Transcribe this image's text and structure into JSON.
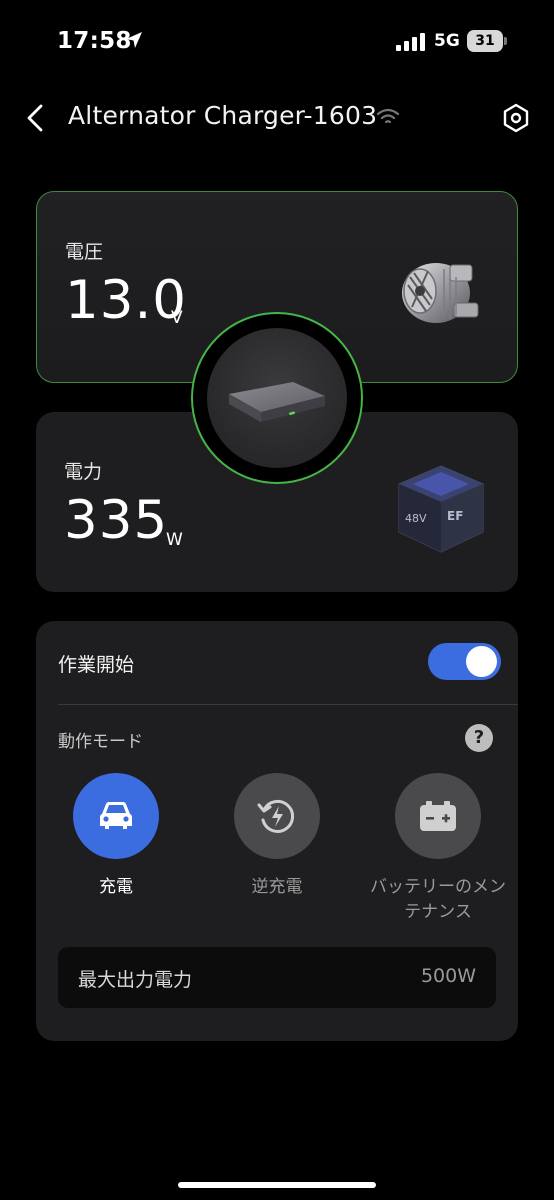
{
  "status_bar": {
    "time": "17:58",
    "network": "5G",
    "battery": "31",
    "icons": [
      "location-arrow-icon",
      "signal-icon",
      "battery-icon"
    ]
  },
  "nav": {
    "title": "Alternator Charger-1603",
    "icons": [
      "back-chevron-icon",
      "wifi-icon",
      "settings-hexagon-icon"
    ]
  },
  "voltage": {
    "label": "電圧",
    "value": "13.0",
    "unit": "V"
  },
  "power": {
    "label": "電力",
    "value": "335",
    "unit": "W",
    "battery_badge": "48V",
    "brand_mark": "EF"
  },
  "control": {
    "work_label": "作業開始",
    "work_enabled": true,
    "mode_label": "動作モード",
    "help_glyph": "?",
    "modes": [
      {
        "label": "充電",
        "icon": "car-icon",
        "active": true
      },
      {
        "label": "逆充電",
        "icon": "reverse-charge-icon",
        "active": false
      },
      {
        "label": "バッテリーのメンテナンス",
        "label_line1": "バッテリーのメン",
        "label_line2": "テナンス",
        "icon": "car-battery-icon",
        "active": false
      }
    ],
    "max_output_label": "最大出力電力",
    "max_output_value": "500W"
  },
  "colors": {
    "background": "#000000",
    "card": "#1e1e20",
    "accent_blue": "#3b6de0",
    "accent_green": "#46b446",
    "muted_text": "#9a9a9a"
  }
}
